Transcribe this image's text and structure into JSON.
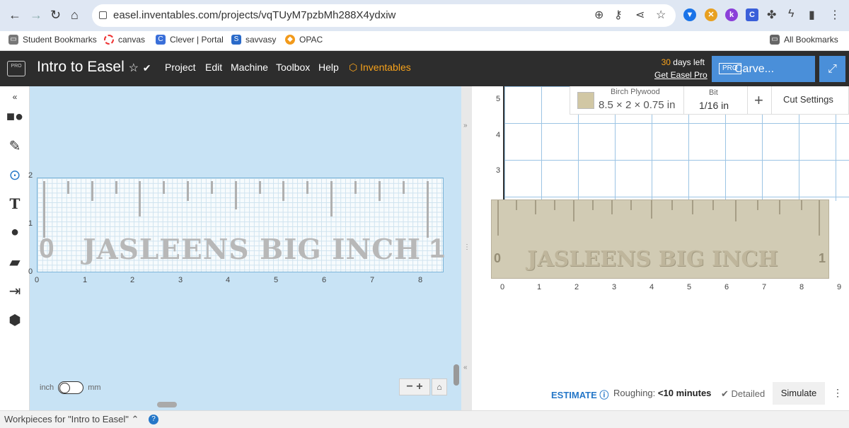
{
  "browser": {
    "url": "easel.inventables.com/projects/vqTUyM7pzbMh288X4ydxiw",
    "back": "←",
    "forward": "→",
    "reload": "↻",
    "home": "⌂"
  },
  "bookmarks": {
    "student": "Student Bookmarks",
    "canvas": "canvas",
    "clever": "Clever | Portal",
    "savvasy": "savvasy",
    "opac": "OPAC",
    "all": "All Bookmarks"
  },
  "app": {
    "logo": "PRO",
    "title": "Intro to Easel",
    "star": "☆",
    "check": "✔",
    "menu": [
      "Project",
      "Edit",
      "Machine",
      "Toolbox",
      "Help"
    ],
    "inventables": "Inventables",
    "days_num": "30",
    "days_text": "days left",
    "get_pro": "Get Easel Pro",
    "carve_pro": "PRO",
    "carve": "Carve...",
    "expand": "⤢"
  },
  "design": {
    "text": "JASLEENS BIG INCH",
    "left_num": "0",
    "right_num": "1",
    "x_ticks": [
      "0",
      "1",
      "2",
      "3",
      "4",
      "5",
      "6",
      "7",
      "8"
    ],
    "y_ticks": [
      "0",
      "1",
      "2"
    ]
  },
  "units": {
    "left": "inch",
    "right": "mm"
  },
  "zoom": {
    "label": "− +",
    "home": "⌂"
  },
  "material": {
    "name": "Birch Plywood",
    "size": "8.5 × 2 × 0.75 in",
    "bit_label": "Bit",
    "bit_value": "1/16 in",
    "plus": "+",
    "cut_settings": "Cut Settings"
  },
  "preview": {
    "text": "JASLEENS BIG INCH",
    "left_num": "0",
    "right_num": "1",
    "x_ticks": [
      "0",
      "1",
      "2",
      "3",
      "4",
      "5",
      "6",
      "7",
      "8",
      "9"
    ],
    "y_ticks": [
      "5",
      "4",
      "3"
    ]
  },
  "estimate": {
    "label": "ESTIMATE ⓘ",
    "roughing": "Roughing:",
    "time": "<10 minutes",
    "detailed": "✔ Detailed",
    "simulate": "Simulate",
    "kebab": "⋮"
  },
  "workpieces": {
    "label": "Workpieces for \"Intro to Easel\" ⌃",
    "help": "?"
  },
  "splitter": {
    "right": "»",
    "left": "«"
  }
}
